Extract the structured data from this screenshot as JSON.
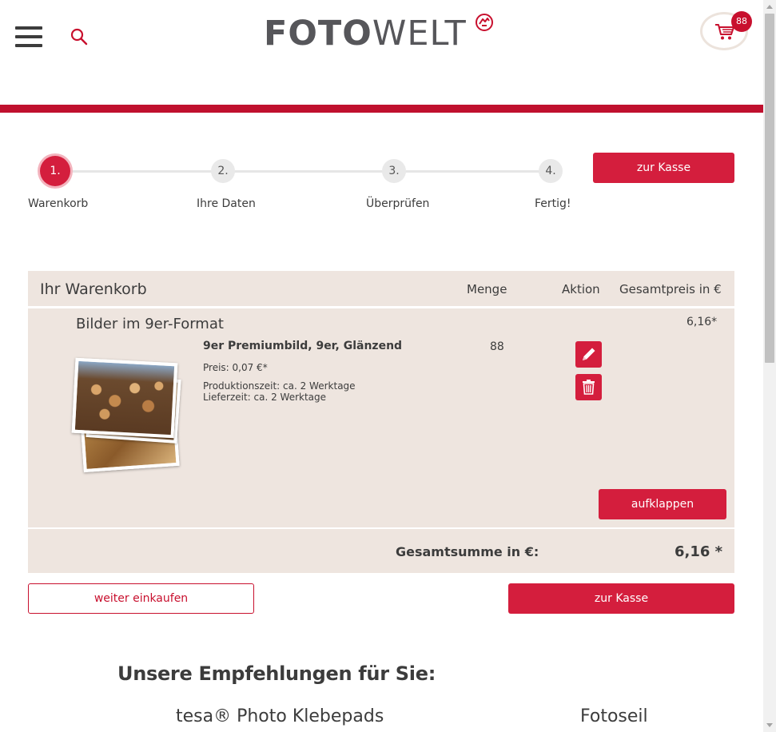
{
  "header": {
    "logo_bold": "FOTO",
    "logo_light": "WELT",
    "cart_count": "88"
  },
  "steps": [
    {
      "number": "1.",
      "label": "Warenkorb",
      "active": true
    },
    {
      "number": "2.",
      "label": "Ihre Daten",
      "active": false
    },
    {
      "number": "3.",
      "label": "Überprüfen",
      "active": false
    },
    {
      "number": "4.",
      "label": "Fertig!",
      "active": false
    }
  ],
  "checkout_top_label": "zur Kasse",
  "cart": {
    "title": "Ihr Warenkorb",
    "col_quantity": "Menge",
    "col_action": "Aktion",
    "col_total": "Gesamtpreis in €",
    "group_title": "Bilder im 9er-Format",
    "group_price": "6,16*",
    "item": {
      "name": "9er Premiumbild, 9er, Glänzend",
      "price": "Preis: 0,07 €*",
      "production": "Produktionszeit: ca. 2 Werktage",
      "delivery": "Lieferzeit: ca. 2 Werktage",
      "quantity": "88"
    },
    "expand_label": "aufklappen",
    "total_label": "Gesamtsumme in €:",
    "total_value": "6,16 *"
  },
  "continue_shopping_label": "weiter einkaufen",
  "checkout_bottom_label": "zur Kasse",
  "recommendations": {
    "heading": "Unsere Empfehlungen für Sie:",
    "items": [
      "tesa® Photo Klebepads",
      "Fotoseil"
    ]
  },
  "colors": {
    "brand_red": "#d41e3d",
    "cart_background": "#eee5df",
    "logo_gray": "#56565a"
  }
}
